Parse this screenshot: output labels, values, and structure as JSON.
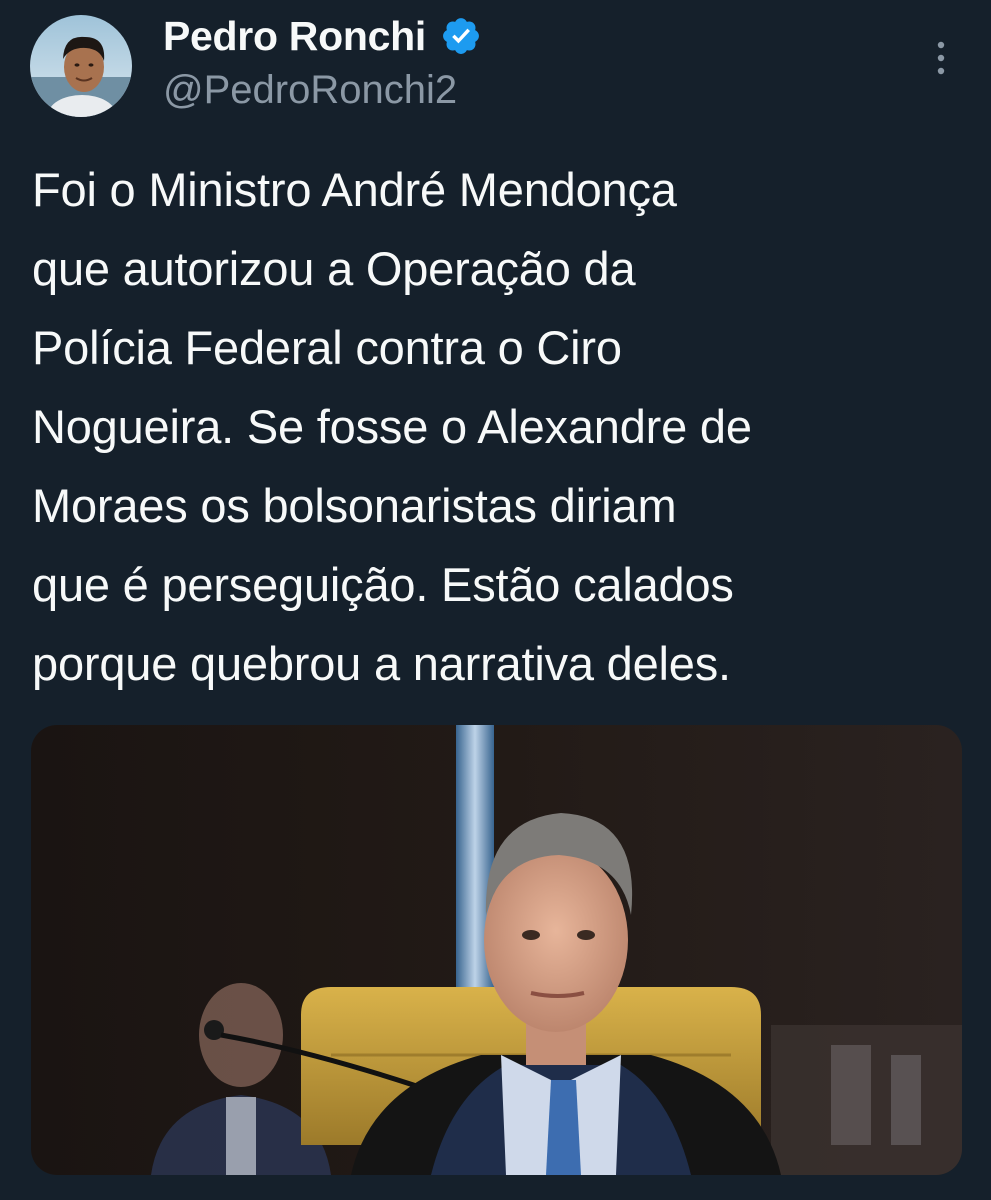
{
  "colors": {
    "background": "#15202b",
    "text_primary": "#f7f9f9",
    "text_secondary": "#8b98a5",
    "verified_badge": "#1d9bf0"
  },
  "author": {
    "display_name": "Pedro Ronchi",
    "handle": "@PedroRonchi2",
    "verified": true
  },
  "tweet": {
    "text": "Foi o Ministro André Mendonça\nque autorizou a Operação da\nPolícia Federal contra o Ciro\nNogueira. Se fosse o Alexandre de\nMoraes os bolsonaristas diriam\nque é perseguição. Estão calados\nporque quebrou a narrativa deles."
  },
  "icons": {
    "verified": "verified-badge-icon",
    "more": "more-options-icon"
  }
}
